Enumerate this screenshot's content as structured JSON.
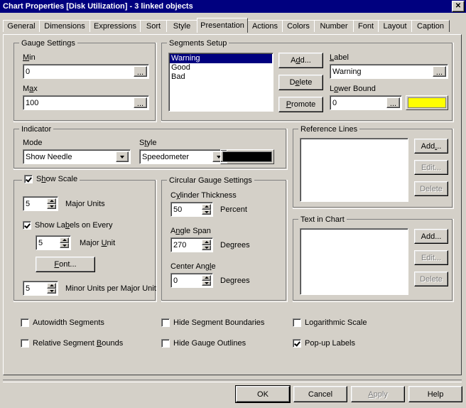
{
  "window": {
    "title": "Chart Properties [Disk Utilization] - 3 linked objects",
    "close_icon": "close-icon",
    "close_glyph": "✕"
  },
  "tabs": [
    {
      "label": "General",
      "selected": false
    },
    {
      "label": "Dimensions",
      "selected": false
    },
    {
      "label": "Expressions",
      "selected": false
    },
    {
      "label": "Sort",
      "selected": false
    },
    {
      "label": "Style",
      "selected": false
    },
    {
      "label": "Presentation",
      "selected": true
    },
    {
      "label": "Actions",
      "selected": false
    },
    {
      "label": "Colors",
      "selected": false
    },
    {
      "label": "Number",
      "selected": false
    },
    {
      "label": "Font",
      "selected": false
    },
    {
      "label": "Layout",
      "selected": false
    },
    {
      "label": "Caption",
      "selected": false
    }
  ],
  "gauge_settings": {
    "caption": "Gauge Settings",
    "min_label": "Min",
    "min_value": "0",
    "max_label": "Max",
    "max_value": "100",
    "ellipsis": "..."
  },
  "segments_setup": {
    "caption": "Segments Setup",
    "items": [
      "Warning",
      "Good",
      "Bad"
    ],
    "selected_index": 0,
    "add_label": "Add...",
    "delete_label": "Delete",
    "promote_label": "Promote",
    "label_caption": "Label",
    "label_value": "Warning",
    "lower_bound_caption": "Lower Bound",
    "lower_bound_value": "0",
    "color": "#ffff00",
    "ellipsis": "..."
  },
  "indicator": {
    "caption": "Indicator",
    "mode_label": "Mode",
    "mode_value": "Show Needle",
    "style_label": "Style",
    "style_value": "Speedometer",
    "color": "#000000"
  },
  "scale": {
    "show_scale_label": "Show Scale",
    "show_scale_checked": true,
    "major_units_value": "5",
    "major_units_label": "Major Units",
    "show_labels_label": "Show Labels on Every",
    "show_labels_checked": true,
    "major_unit_value": "5",
    "major_unit_label": "Major Unit",
    "font_button": "Font...",
    "minor_units_value": "5",
    "minor_units_label": "Minor Units per Major Unit"
  },
  "circular": {
    "caption": "Circular Gauge Settings",
    "cylinder_thickness_label": "Cylinder Thickness",
    "cylinder_thickness_value": "50",
    "cylinder_thickness_unit": "Percent",
    "angle_span_label": "Angle Span",
    "angle_span_value": "270",
    "angle_span_unit": "Degrees",
    "center_angle_label": "Center Angle",
    "center_angle_value": "0",
    "center_angle_unit": "Degrees"
  },
  "reference_lines": {
    "caption": "Reference Lines",
    "items": [],
    "add_label": "Add...",
    "edit_label": "Edit...",
    "delete_label": "Delete",
    "edit_enabled": false,
    "delete_enabled": false
  },
  "text_in_chart": {
    "caption": "Text in Chart",
    "items": [],
    "add_label": "Add...",
    "edit_label": "Edit...",
    "delete_label": "Delete",
    "edit_enabled": false,
    "delete_enabled": false
  },
  "options": [
    {
      "label": "Autowidth Segments",
      "checked": false
    },
    {
      "label": "Relative Segment Bounds",
      "checked": false
    },
    {
      "label": "Hide Segment Boundaries",
      "checked": false
    },
    {
      "label": "Hide Gauge Outlines",
      "checked": false
    },
    {
      "label": "Logarithmic Scale",
      "checked": false
    },
    {
      "label": "Pop-up Labels",
      "checked": true
    }
  ],
  "footer": {
    "ok": "OK",
    "cancel": "Cancel",
    "apply": "Apply",
    "help": "Help",
    "apply_enabled": false
  }
}
